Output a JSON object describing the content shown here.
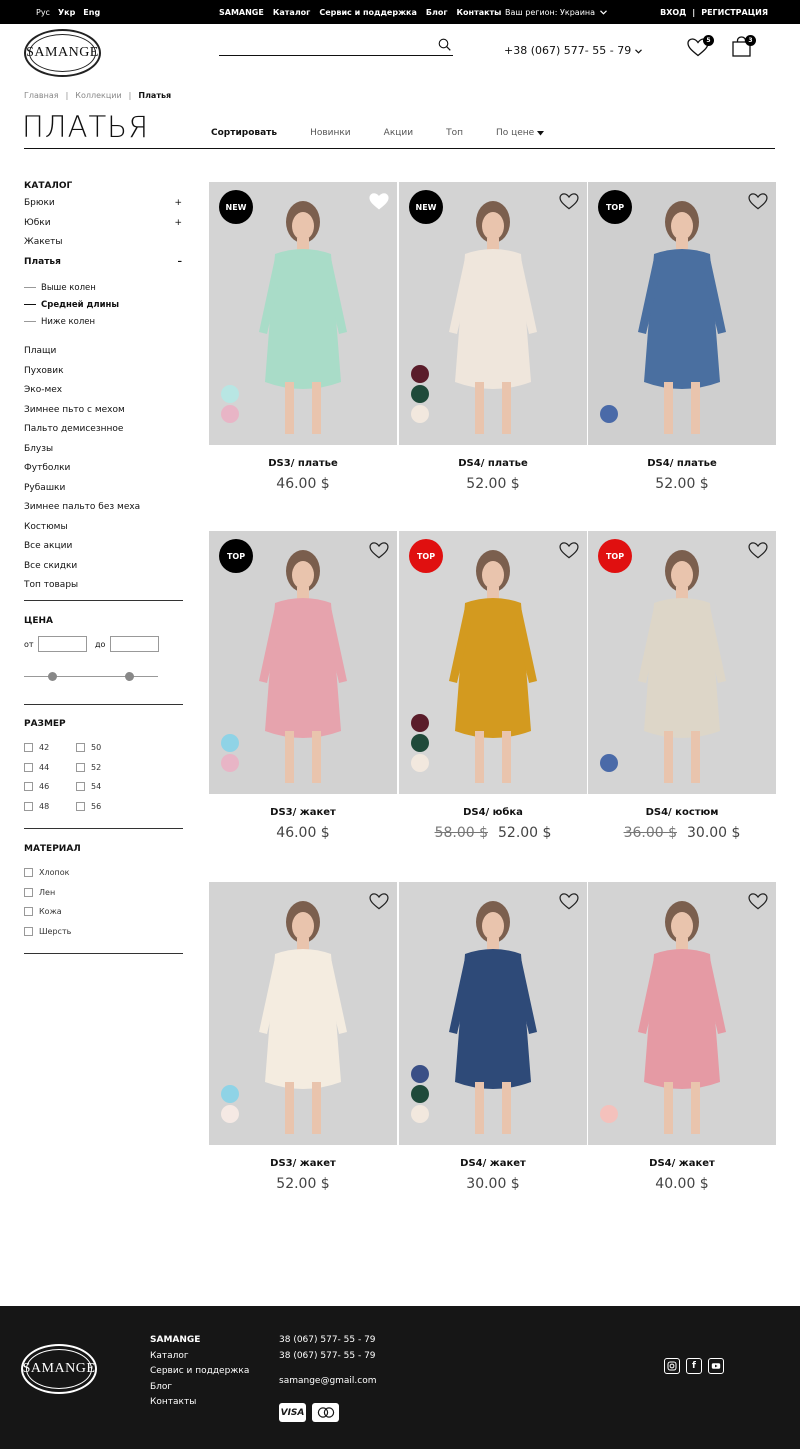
{
  "topbar": {
    "langs": [
      "Рус",
      "Укр",
      "Eng"
    ],
    "active_lang": "Укр",
    "nav": [
      "SAMANGE",
      "Каталог",
      "Сервис и поддержка",
      "Блог",
      "Контакты"
    ],
    "region": "Ваш регион: Украина",
    "login": "ВХОД",
    "sep": "|",
    "register": "РЕГИСТРАЦИЯ"
  },
  "header": {
    "logo": "SAMANGE",
    "search_placeholder": "",
    "phone": "+38 (067) 577- 55 - 79",
    "favorites_count": "5",
    "cart_count": "3"
  },
  "breadcrumbs": [
    "Главная",
    "|",
    "Коллекции",
    "|",
    "Платья"
  ],
  "page_title": "ПЛАТЬЯ",
  "sort": {
    "label": "Сортировать",
    "options": [
      "Новинки",
      "Акции",
      "Топ",
      "По цене"
    ]
  },
  "sidebar": {
    "catalog_title": "КАТАЛОГ",
    "categories": [
      {
        "label": "Брюки",
        "toggle": "+"
      },
      {
        "label": "Юбки",
        "toggle": "+"
      },
      {
        "label": "Жакеты",
        "toggle": ""
      },
      {
        "label": "Платья",
        "toggle": "–"
      }
    ],
    "subcategories": [
      "Выше колен",
      "Средней длины",
      "Ниже колен"
    ],
    "more_categories": [
      "Плащи",
      "Пуховик",
      "Эко-мех",
      "Зимнее пьто с мехом",
      "Пальто демисезнное",
      "Блузы",
      "Футболки",
      "Рубашки",
      "Зимнее пальто без меха",
      "Костюмы",
      "Все акции",
      "Все скидки",
      "Топ товары"
    ],
    "price_title": "ЦЕНА",
    "price_from": "от",
    "price_to": "до",
    "size_title": "РАЗМЕР",
    "sizes": [
      "42",
      "44",
      "46",
      "48",
      "50",
      "52",
      "54",
      "56"
    ],
    "material_title": "МАТЕРИАЛ",
    "materials": [
      "Хлопок",
      "Лен",
      "Кожа",
      "Шерсть"
    ]
  },
  "products": [
    {
      "name": "DS3/ платье",
      "price": "46.00 $",
      "old_price": "",
      "tag": "NEW",
      "tag_color": "#000000",
      "liked": true,
      "swatches": [
        "#b8e6e3",
        "#e8b5c6"
      ],
      "bg": "#d4d4d4",
      "garment": "#a9dcc8"
    },
    {
      "name": "DS4/ платье",
      "price": "52.00 $",
      "old_price": "",
      "tag": "NEW",
      "tag_color": "#000000",
      "liked": false,
      "swatches": [
        "#5a1c2a",
        "#1f4a3a",
        "#f2e8de"
      ],
      "bg": "#d3d3d3",
      "garment": "#efe6dc"
    },
    {
      "name": "DS4/ платье",
      "price": "52.00 $",
      "old_price": "",
      "tag": "TOP",
      "tag_color": "#000000",
      "liked": false,
      "swatches": [
        "#4a6aa8"
      ],
      "bg": "#cfcfcf",
      "garment": "#4a6fa0"
    },
    {
      "name": "DS3/ жакет",
      "price": "46.00 $",
      "old_price": "",
      "tag": "TOP",
      "tag_color": "#000000",
      "liked": false,
      "swatches": [
        "#8fd3e6",
        "#e8b5c6"
      ],
      "bg": "#d2d2d2",
      "garment": "#e6a3ad"
    },
    {
      "name": "DS4/ юбка",
      "price": "52.00 $",
      "old_price": "58.00 $",
      "tag": "TOP",
      "tag_color": "#e01010",
      "liked": false,
      "swatches": [
        "#5a1c2a",
        "#1f4a3a",
        "#f2e8de"
      ],
      "bg": "#d6d6d6",
      "garment": "#d39a1f"
    },
    {
      "name": "DS4/ костюм",
      "price": "30.00 $",
      "old_price": "36.00 $",
      "tag": "TOP",
      "tag_color": "#e01010",
      "liked": false,
      "swatches": [
        "#4a6aa8"
      ],
      "bg": "#d4d4d4",
      "garment": "#ddd6c8"
    },
    {
      "name": "DS3/ жакет",
      "price": "52.00 $",
      "old_price": "",
      "tag": "",
      "tag_color": "",
      "liked": false,
      "swatches": [
        "#8fd3e6",
        "#f5e9e4"
      ],
      "bg": "#d3d3d3",
      "garment": "#f4ece0"
    },
    {
      "name": "DS4/ жакет",
      "price": "30.00 $",
      "old_price": "",
      "tag": "",
      "tag_color": "",
      "liked": false,
      "swatches": [
        "#3a4f86",
        "#1f4a3a",
        "#f2e8de"
      ],
      "bg": "#d4d4d4",
      "garment": "#2e4a78"
    },
    {
      "name": "DS4/ жакет",
      "price": "40.00 $",
      "old_price": "",
      "tag": "",
      "tag_color": "",
      "liked": false,
      "swatches": [
        "#f4c1bc"
      ],
      "bg": "#d3d3d3",
      "garment": "#e59aa4"
    }
  ],
  "footer": {
    "logo": "SAMANGE",
    "links": [
      "SAMANGE",
      "Каталог",
      "Сервис и поддержка",
      "Блог",
      "Контакты"
    ],
    "phones": [
      "38 (067) 577- 55 - 79",
      "38 (067) 577- 55 - 79"
    ],
    "email": "samange@gmail.com",
    "payments": [
      "VISA",
      "MC"
    ],
    "social": [
      "instagram-icon",
      "facebook-icon",
      "youtube-icon"
    ]
  }
}
